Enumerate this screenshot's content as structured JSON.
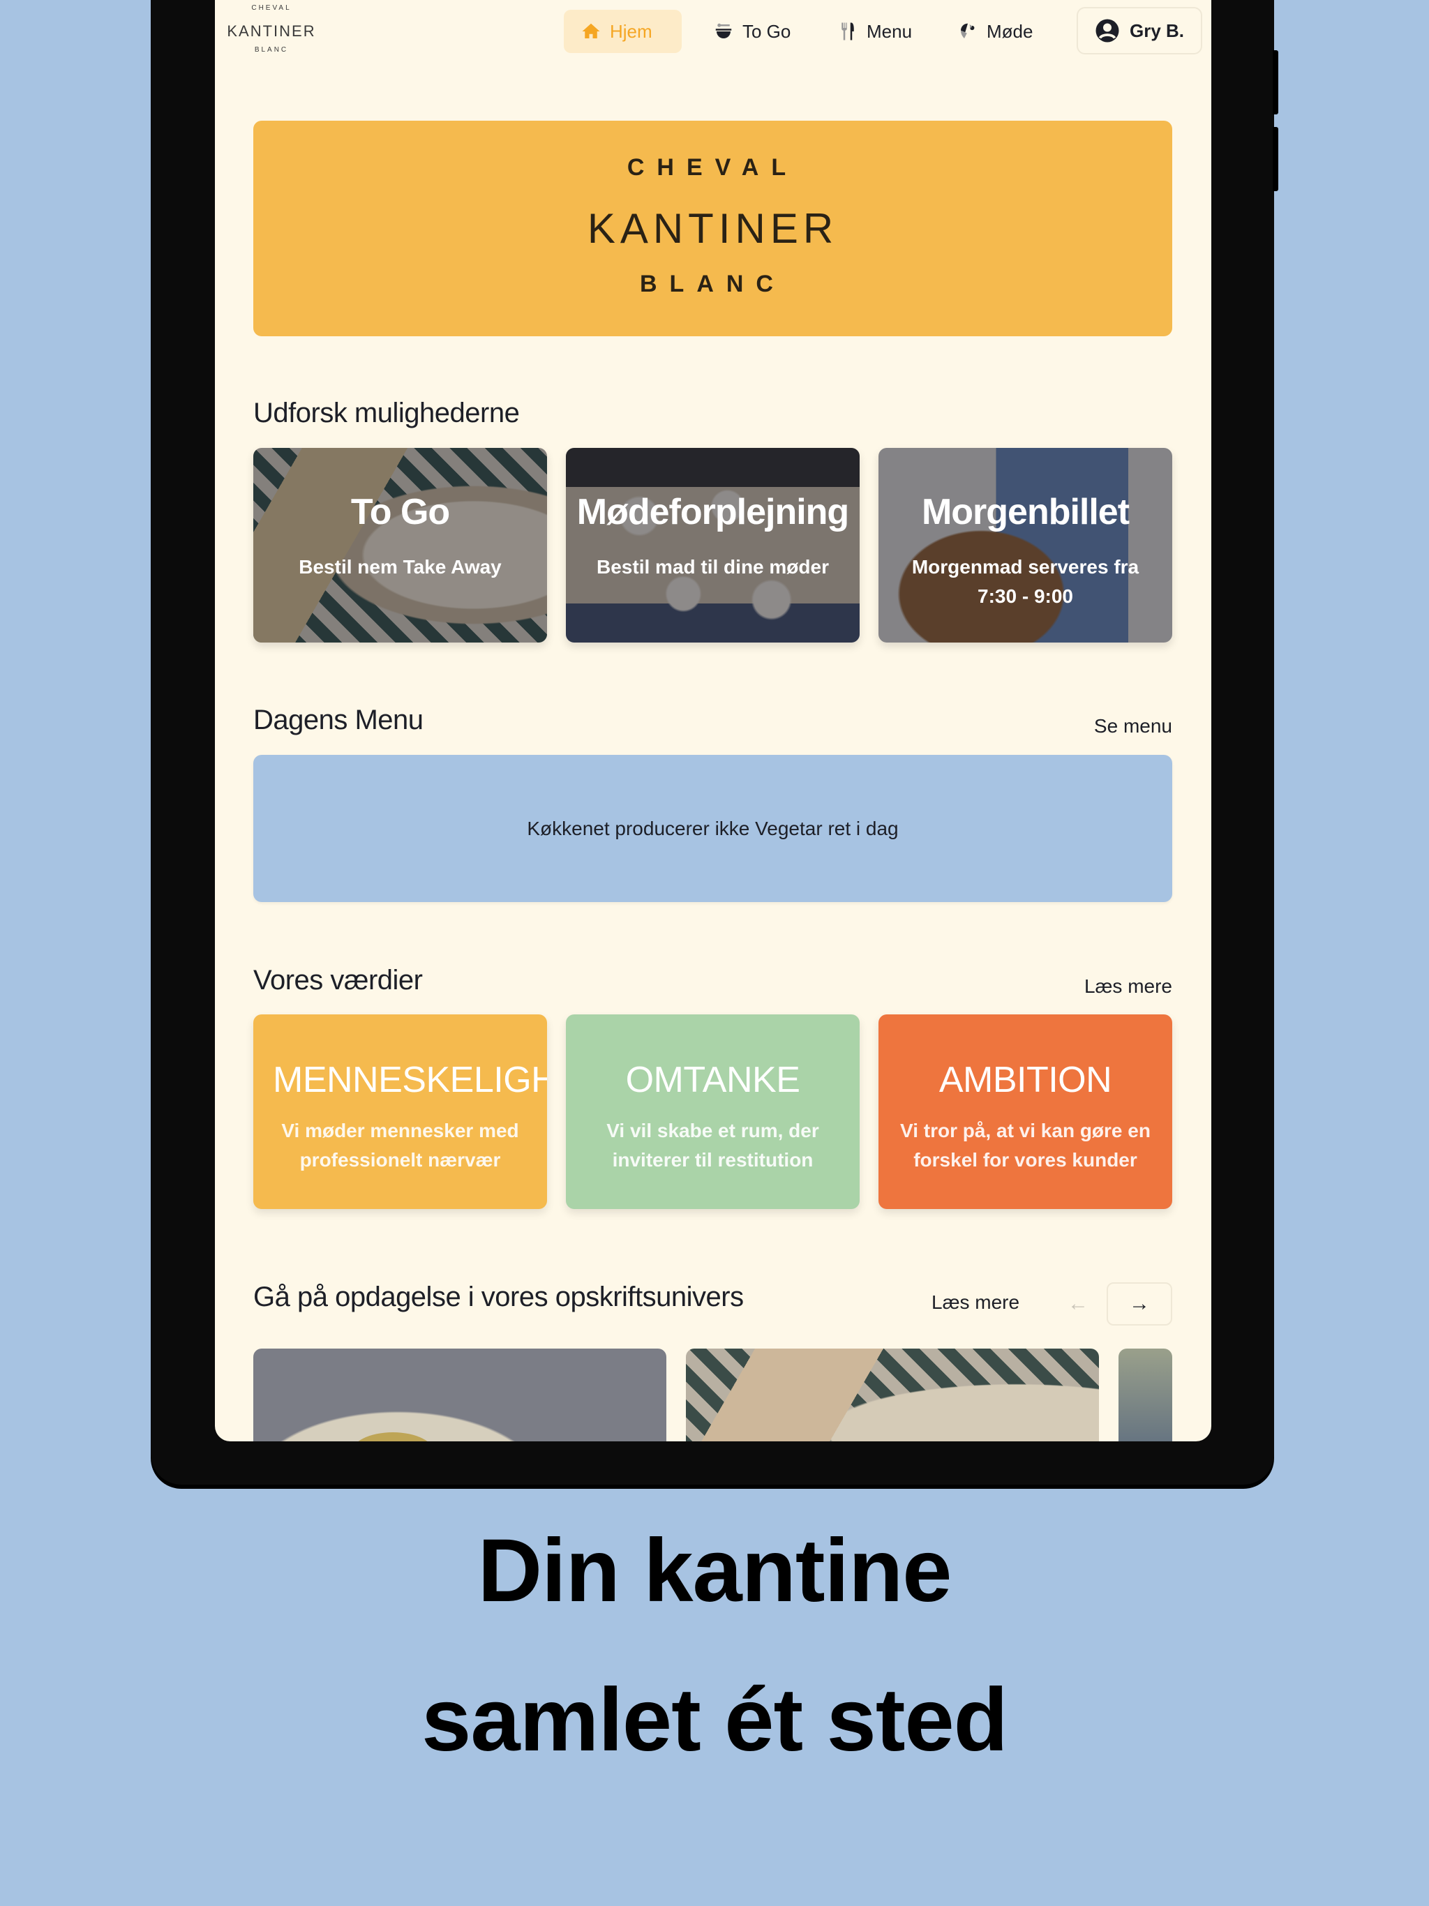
{
  "nav": {
    "logo": {
      "top": "CHEVAL",
      "middle": "KANTINER",
      "bottom": "BLANC"
    },
    "items": [
      {
        "label": "Hjem",
        "icon": "home-icon",
        "active": true
      },
      {
        "label": "To Go",
        "icon": "bowl-icon",
        "active": false
      },
      {
        "label": "Menu",
        "icon": "fork-knife-icon",
        "active": false
      },
      {
        "label": "Møde",
        "icon": "croissant-icon",
        "active": false
      }
    ],
    "user": {
      "label": "Gry B.",
      "icon": "user-circle-icon"
    }
  },
  "hero": {
    "top": "CHEVAL",
    "middle": "KANTINER",
    "bottom": "BLANC"
  },
  "explore": {
    "title": "Udforsk mulighederne",
    "cards": [
      {
        "title": "To Go",
        "subtitle": "Bestil nem Take Away"
      },
      {
        "title": "Mødeforplejning",
        "subtitle": "Bestil mad til dine møder"
      },
      {
        "title": "Morgenbillet",
        "subtitle": "Morgenmad serveres fra 7:30 - 9:00"
      }
    ]
  },
  "daily_menu": {
    "title": "Dagens Menu",
    "link": "Se menu",
    "message": "Køkkenet producerer ikke Vegetar ret i dag"
  },
  "values": {
    "title": "Vores værdier",
    "link": "Læs mere",
    "cards": [
      {
        "title": "MENNESKELIGHED",
        "text": "Vi møder mennesker med professionelt nærvær",
        "color": "#F5BA4E"
      },
      {
        "title": "OMTANKE",
        "text": "Vi vil skabe et rum, der inviterer til restitution",
        "color": "#AAD3A8"
      },
      {
        "title": "AMBITION",
        "text": "Vi tror på, at vi kan gøre en forskel for vores kunder",
        "color": "#EE753E"
      }
    ]
  },
  "recipes": {
    "title": "Gå på opdagelse i vores opskriftsunivers",
    "link": "Læs mere",
    "prev": "←",
    "next": "→"
  },
  "tagline": {
    "line1": "Din kantine",
    "line2": "samlet ét sted"
  },
  "colors": {
    "background": "#A7C3E2",
    "screen": "#FEF8E8",
    "accent": "#F5A623",
    "hero": "#F5BA4E"
  }
}
